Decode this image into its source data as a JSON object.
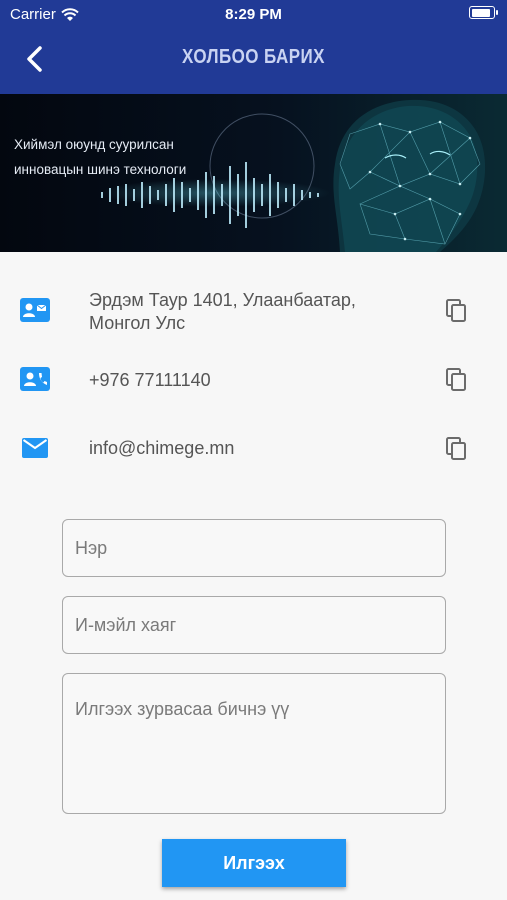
{
  "status_bar": {
    "carrier": "Carrier",
    "time": "8:29 PM"
  },
  "header": {
    "title": "ХОЛБОО БАРИХ",
    "back_icon": "chevron-left-icon"
  },
  "banner": {
    "tagline": "Хиймэл оюунд суурилсан инновацын шинэ технологи"
  },
  "contacts": [
    {
      "icon": "contact-card-icon",
      "text": "Эрдэм Таур 1401, Улаанбаатар, Монгол Улс"
    },
    {
      "icon": "contact-phone-icon",
      "text": "+976 77111140"
    },
    {
      "icon": "mail-icon",
      "text": "info@chimege.mn"
    }
  ],
  "form": {
    "name_placeholder": "Нэр",
    "email_placeholder": "И-мэйл хаяг",
    "message_placeholder": "Илгээх зурвасаа бичнэ үү",
    "send_label": "Илгээх"
  },
  "colors": {
    "header": "#213a96",
    "accent": "#2196f3",
    "banner": "#050a18"
  }
}
